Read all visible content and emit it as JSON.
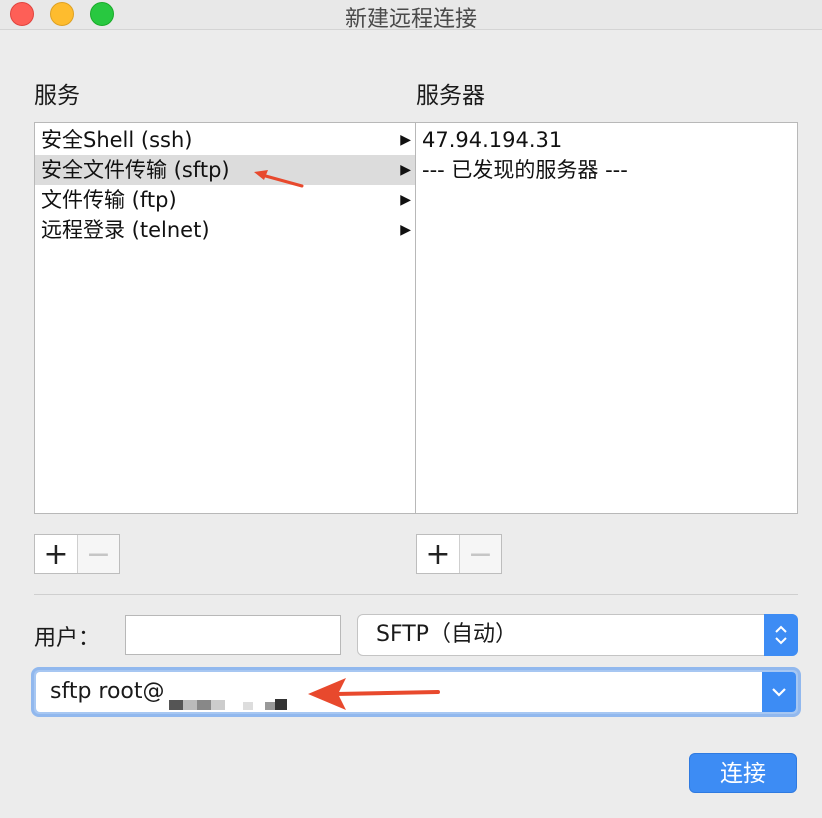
{
  "window": {
    "title": "新建远程连接"
  },
  "services": {
    "label": "服务",
    "items": [
      {
        "label": "安全Shell (ssh)",
        "arrow": "▶"
      },
      {
        "label": "安全文件传输 (sftp)",
        "arrow": "▶"
      },
      {
        "label": "文件传输 (ftp)",
        "arrow": "▶"
      },
      {
        "label": "远程登录 (telnet)",
        "arrow": "▶"
      }
    ],
    "add": "+",
    "remove": "−"
  },
  "servers": {
    "label": "服务器",
    "items": [
      {
        "label": "47.94.194.31"
      },
      {
        "label": "--- 已发现的服务器 ---"
      }
    ],
    "add": "+",
    "remove": "−"
  },
  "user": {
    "label": "用户：",
    "value": ""
  },
  "protocol": {
    "selected": "SFTP（自动）"
  },
  "command": {
    "value": "sftp root@"
  },
  "connect": {
    "label": "连接"
  },
  "colors": {
    "accent": "#3d8cf4",
    "annotation": "#e8492d",
    "selection": "#dcdcdc"
  }
}
